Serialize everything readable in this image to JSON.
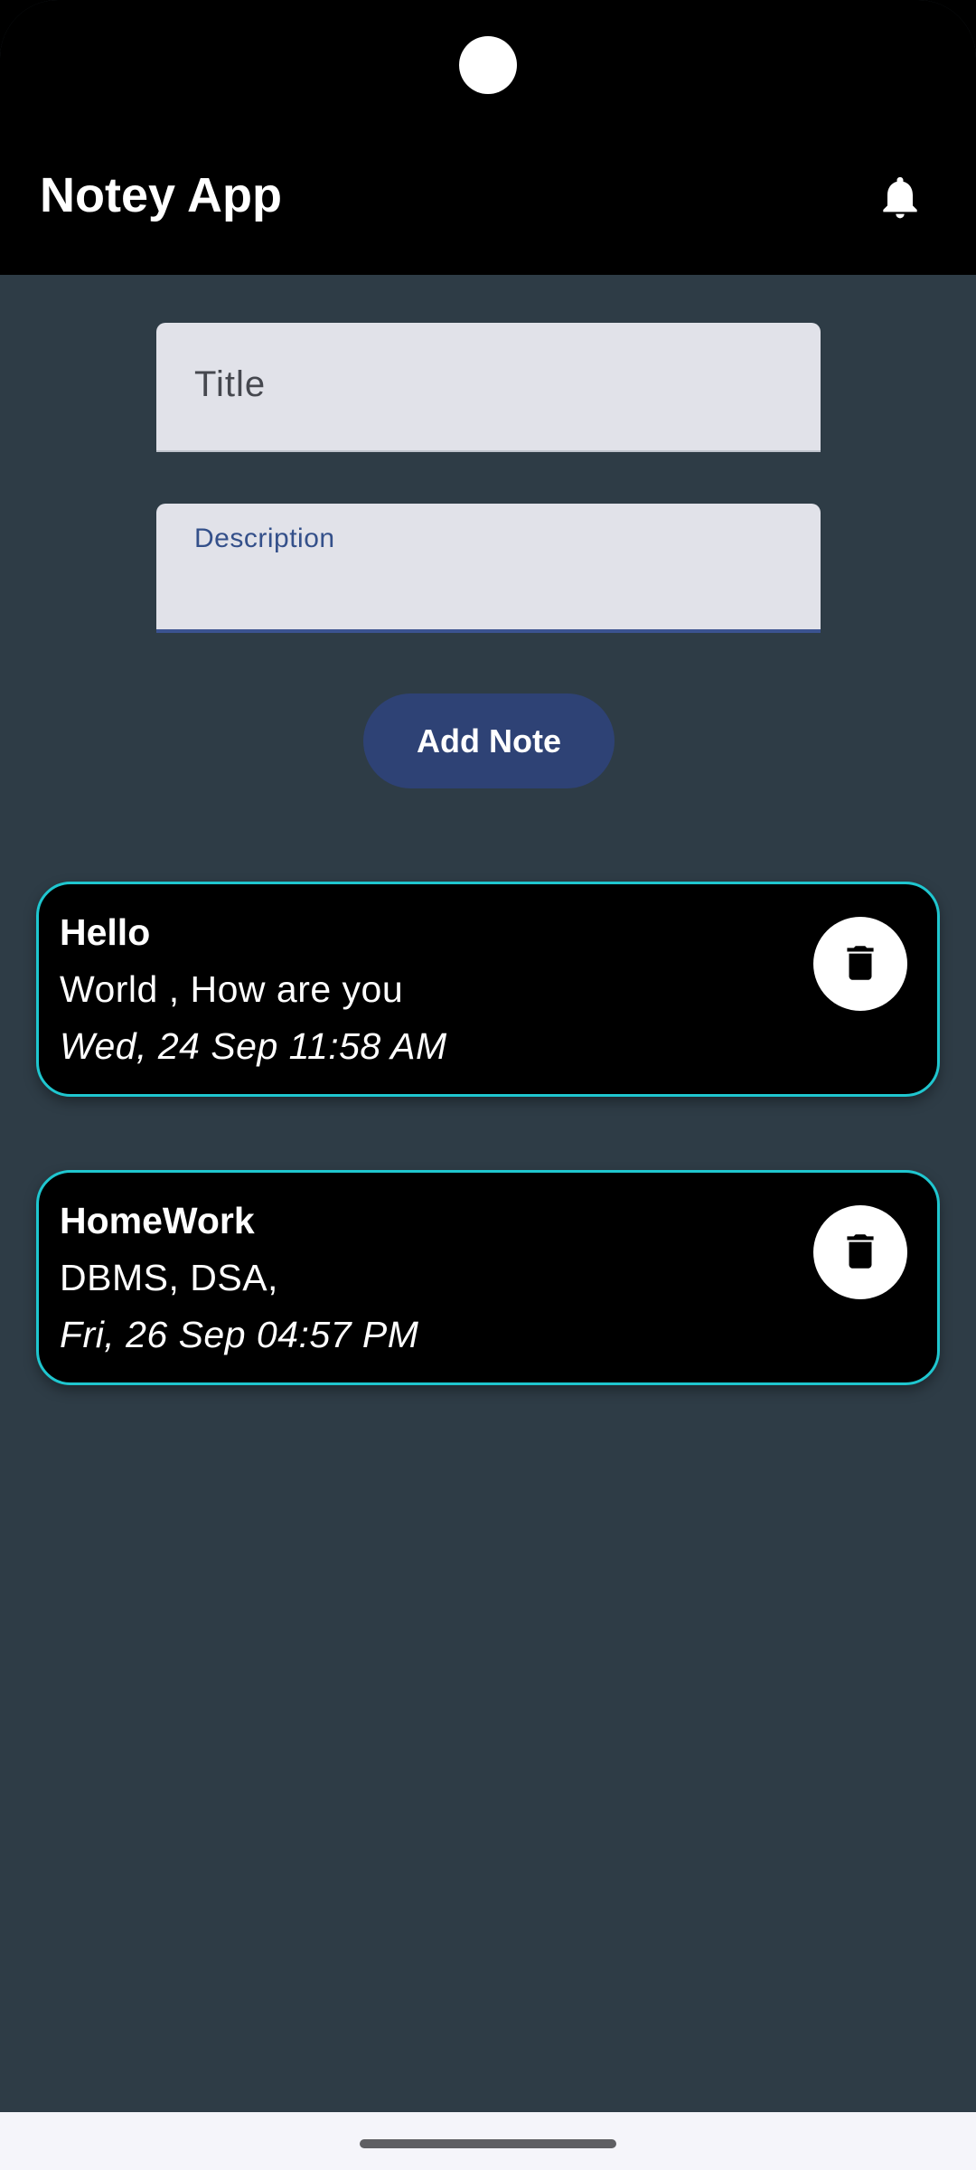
{
  "app": {
    "title": "Notey App"
  },
  "form": {
    "title_placeholder": "Title",
    "title_value": "",
    "description_label": "Description",
    "description_value": "",
    "add_button_label": "Add Note"
  },
  "notes": [
    {
      "title": "Hello",
      "description": "World , How are you",
      "date": "Wed, 24 Sep 11:58 AM"
    },
    {
      "title": "HomeWork",
      "description": "DBMS, DSA,",
      "date": "Fri, 26 Sep 04:57 PM"
    }
  ],
  "icons": {
    "notifications": "bell-icon",
    "delete": "trash-icon"
  },
  "colors": {
    "background": "#2e3c46",
    "app_bar": "#000000",
    "button": "#2e4275",
    "card_border": "#1fc6cf",
    "field": "#e1e2e9"
  }
}
